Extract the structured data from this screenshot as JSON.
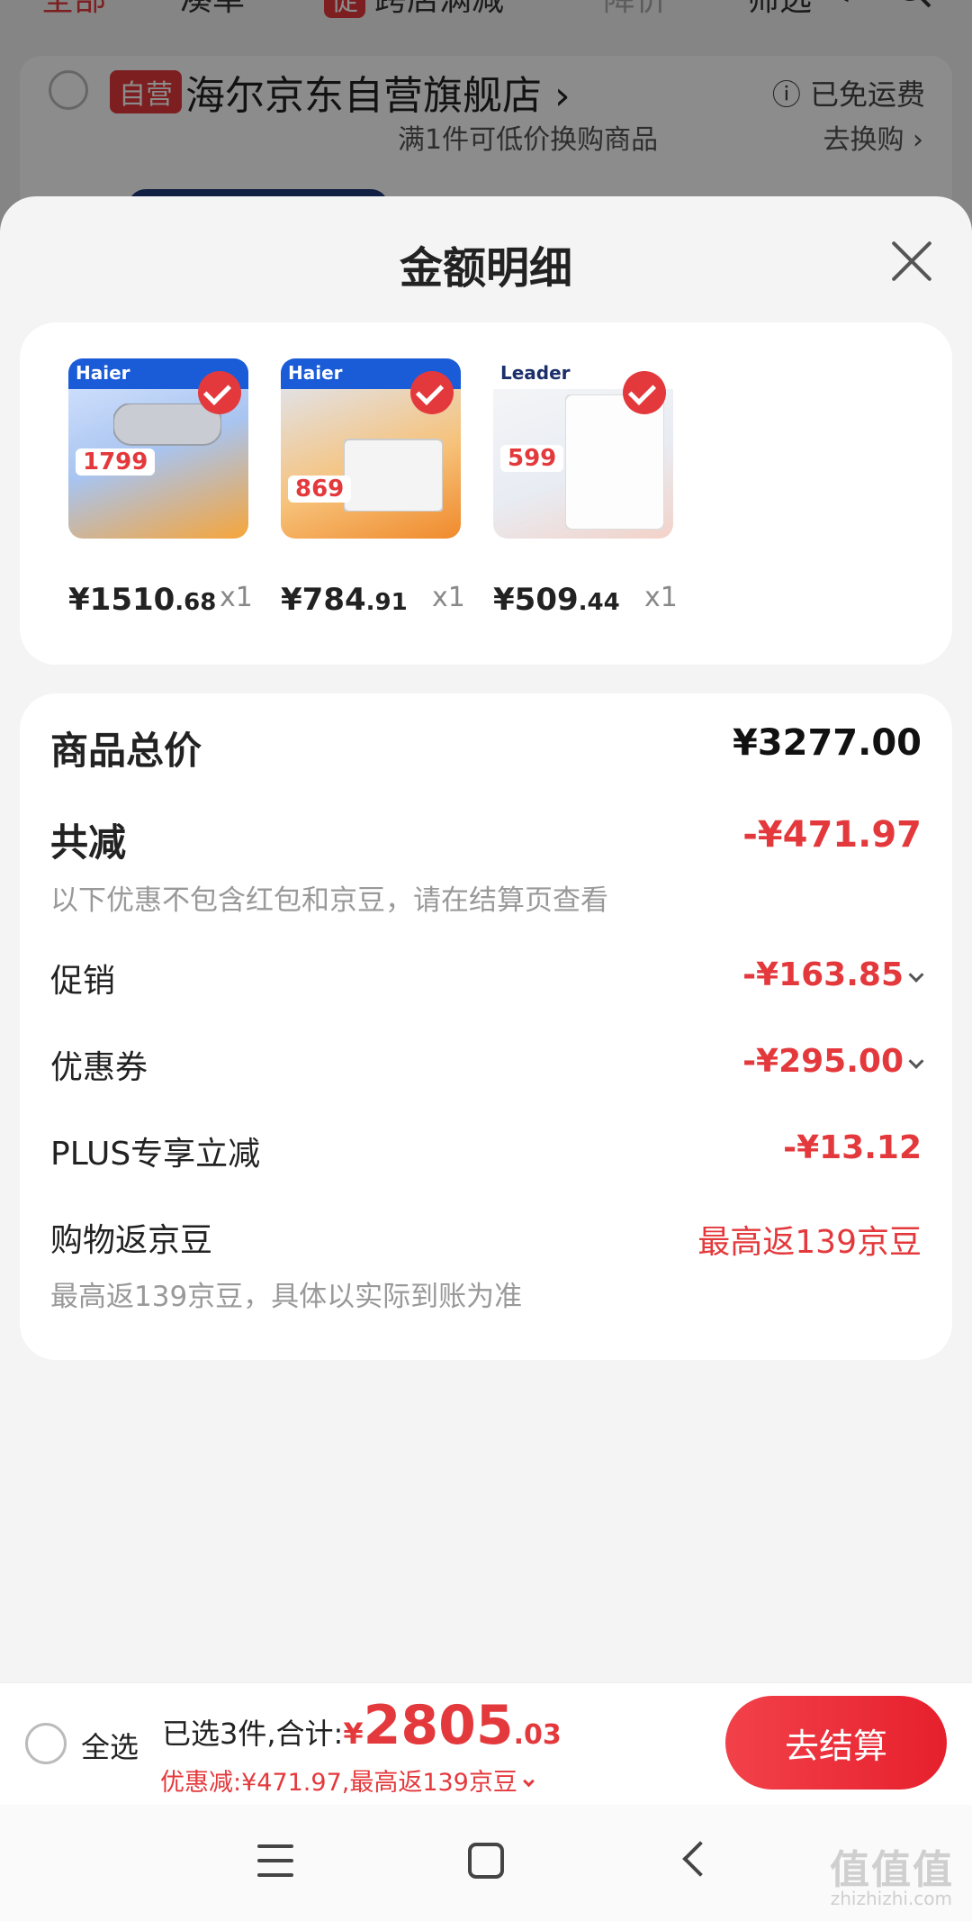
{
  "background": {
    "tabs": [
      {
        "label": "全部",
        "state": "active"
      },
      {
        "label": "凑单",
        "state": "normal"
      },
      {
        "label": "跨店满减",
        "tag": "促",
        "state": "normal"
      },
      {
        "label": "降价",
        "state": "muted"
      },
      {
        "label": "筛选",
        "state": "normal"
      }
    ],
    "store": {
      "badge": "自营",
      "name": "海尔京东自营旗舰店 ›",
      "shipping": "ⓘ 已免运费",
      "promo": "满1件可低价换购商品",
      "swap": "去换购 ›"
    }
  },
  "sheet": {
    "title": "金额明细",
    "products": [
      {
        "brand": "Haier",
        "thumb_price": "1799",
        "price_int": "¥1510",
        "price_dec": ".68",
        "qty": "x1",
        "banner_color": "#1a5bd8"
      },
      {
        "brand": "Haier",
        "thumb_price": "869",
        "price_int": "¥784",
        "price_dec": ".91",
        "qty": "x1",
        "banner_color": "#1a5bd8"
      },
      {
        "brand": "Leader",
        "thumb_price": "599",
        "price_int": "¥509",
        "price_dec": ".44",
        "qty": "x1",
        "banner_color": "#2b4fa8"
      }
    ],
    "details": {
      "total_label": "商品总价",
      "total_value": "¥3277.00",
      "reduce_label": "共减",
      "reduce_value": "-¥471.97",
      "reduce_note": "以下优惠不包含红包和京豆，请在结算页查看",
      "promo_label": "促销",
      "promo_value": "-¥163.85",
      "coupon_label": "优惠券",
      "coupon_value": "-¥295.00",
      "plus_label": "PLUS专享立减",
      "plus_value": "-¥13.12",
      "beans_label": "购物返京豆",
      "beans_value": "最高返139京豆",
      "beans_note": "最高返139京豆，具体以实际到账为准"
    }
  },
  "checkout": {
    "select_all": "全选",
    "selected_text": "已选3件,合计:",
    "yen": "¥",
    "amount_int": "2805",
    "amount_dec": ".03",
    "discount_text": "优惠减:¥471.97,最高返139京豆",
    "button": "去结算"
  },
  "watermark": {
    "text": "值值值",
    "sub": "zhizhizhi.com"
  },
  "colors": {
    "accent": "#e4393c",
    "sheet_bg": "#f4f4f4"
  }
}
